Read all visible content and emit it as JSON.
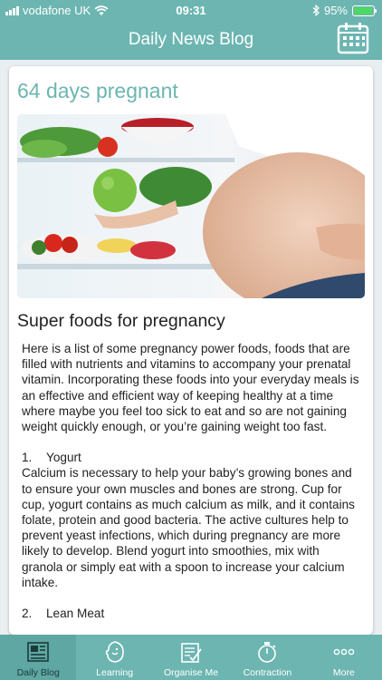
{
  "status_bar": {
    "carrier": "vodafone UK",
    "time": "09:31",
    "battery_percent": "95%",
    "battery_level": 0.95
  },
  "nav": {
    "title": "Daily News Blog",
    "right_icon": "calendar-icon"
  },
  "article": {
    "title": "64 days pregnant",
    "image_alt": "pregnant woman holding green apple in front of open fridge",
    "heading": "Super foods for pregnancy",
    "intro": "Here is a list of some pregnancy power foods, foods that are filled with nutrients and vitamins to accompany your prenatal vitamin. Incorporating these foods into your everyday meals is an effective and efficient way of keeping healthy at a time where maybe you feel too sick to eat and so are not gaining weight quickly enough, or you’re gaining weight too fast.",
    "items": [
      {
        "number": "1.",
        "name": "Yogurt",
        "text": "Calcium is necessary to help your baby’s growing bones and to ensure your own muscles and bones are strong. Cup for cup, yogurt contains as much calcium as milk, and it contains folate, protein and good bacteria. The active cultures help to prevent yeast infections, which during pregnancy are more likely to develop. Blend yogurt into smoothies, mix with granola or simply eat with a spoon to increase your calcium intake."
      },
      {
        "number": "2.",
        "name": "Lean Meat",
        "text": ""
      }
    ]
  },
  "tabs": [
    {
      "label": "Daily Blog",
      "icon": "blog-icon",
      "active": true
    },
    {
      "label": "Learning",
      "icon": "baby-head-icon",
      "active": false
    },
    {
      "label": "Organise Me",
      "icon": "checklist-icon",
      "active": false
    },
    {
      "label": "Contraction",
      "icon": "stopwatch-icon",
      "active": false
    },
    {
      "label": "More",
      "icon": "more-dots-icon",
      "active": false
    }
  ],
  "colors": {
    "brand_teal": "#6cb5b1",
    "active_tab": "#5ea7a3",
    "battery_green": "#4cd964"
  }
}
